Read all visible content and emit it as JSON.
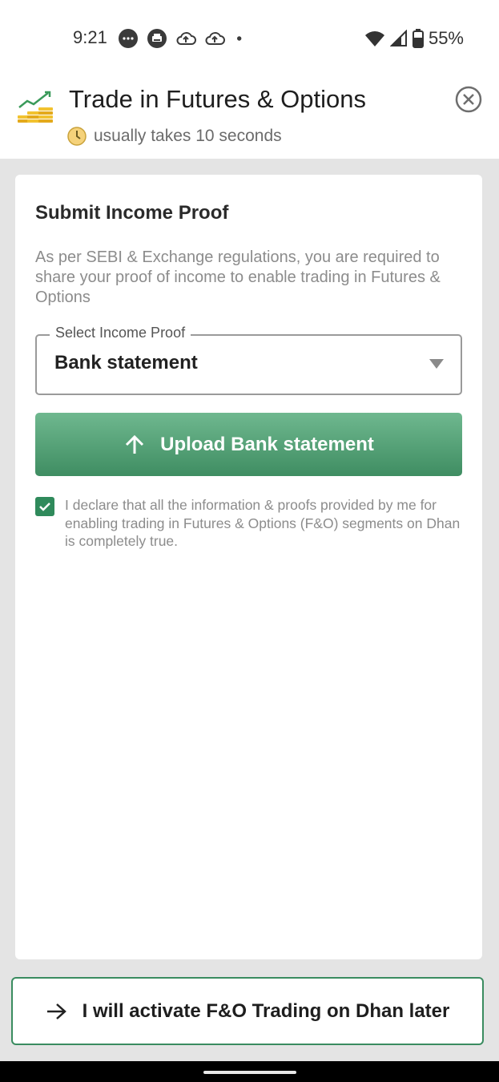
{
  "status_bar": {
    "time": "9:21",
    "battery_percent": "55%",
    "notification_icons": [
      "chat-bubble-icon",
      "printer-icon",
      "cloud-upload-icon",
      "cloud-upload-icon",
      "dot-icon"
    ],
    "system_icons": [
      "wifi-icon",
      "signal-icon",
      "battery-icon"
    ]
  },
  "header": {
    "title": "Trade in Futures & Options",
    "subtitle": "usually takes 10 seconds",
    "logo_icon": "gold-coins-chart-icon",
    "clock_icon": "clock-icon",
    "close_icon": "close-circle-icon"
  },
  "card": {
    "title": "Submit Income Proof",
    "description": "As per SEBI & Exchange regulations, you are required to share your proof of income to enable trading in Futures & Options",
    "select": {
      "label": "Select Income Proof",
      "value": "Bank statement"
    },
    "upload_button": "Upload Bank statement",
    "declaration": {
      "checked": true,
      "text": "I declare that all the information & proofs provided by me for enabling trading in Futures & Options (F&O) segments on Dhan is completely true."
    }
  },
  "footer": {
    "later_button": "I will activate F&O Trading on Dhan later"
  },
  "colors": {
    "accent_green": "#3f8d62",
    "upload_gradient_top": "#6fb88f",
    "checkbox_green": "#2f8a5b",
    "background_grey": "#e4e4e4"
  }
}
